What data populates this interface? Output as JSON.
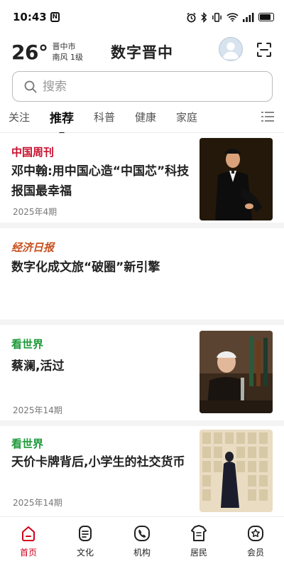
{
  "status_bar": {
    "time": "10:43",
    "nfc_label": "N",
    "icons": [
      "alarm-icon",
      "bluetooth-icon",
      "vibrate-icon",
      "wifi-icon",
      "signal-icon",
      "battery-icon"
    ]
  },
  "header": {
    "temperature": "26°",
    "city": "晋中市",
    "wind": "南风  1级",
    "app_title": "数字晋中",
    "avatar_icon": "user-avatar-icon",
    "scan_icon": "scan-icon"
  },
  "search": {
    "placeholder": "搜索",
    "icon": "search-icon"
  },
  "tabs": {
    "items": [
      {
        "label": "关注",
        "active": false
      },
      {
        "label": "推荐",
        "active": true
      },
      {
        "label": "科普",
        "active": false
      },
      {
        "label": "健康",
        "active": false
      },
      {
        "label": "家庭",
        "active": false
      }
    ],
    "menu_icon": "menu-list-icon"
  },
  "feed": {
    "items": [
      {
        "source": "中国周刊",
        "title": "邓中翰:用中国心造“中国芯”科技报国最幸福",
        "date": "2025年4期",
        "source_color": "#c8102e"
      },
      {
        "source": "经济日报",
        "title": "数字化成文旅“破圈”新引擎",
        "date": "",
        "source_color": "#c8501e"
      },
      {
        "source": "看世界",
        "title": "蔡澜,活过",
        "date": "2025年14期",
        "source_color": "#1e9a3a"
      },
      {
        "source": "看世界",
        "title": "天价卡牌背后,小学生的社交货币",
        "date": "2025年14期",
        "source_color": "#1e9a3a"
      }
    ]
  },
  "bottom_nav": {
    "items": [
      {
        "label": "首页",
        "icon": "home-icon",
        "active": true
      },
      {
        "label": "文化",
        "icon": "culture-icon",
        "active": false
      },
      {
        "label": "机构",
        "icon": "phone-icon",
        "active": false
      },
      {
        "label": "居民",
        "icon": "resident-icon",
        "active": false
      },
      {
        "label": "会员",
        "icon": "member-icon",
        "active": false
      }
    ],
    "active_color": "#d0021b"
  }
}
